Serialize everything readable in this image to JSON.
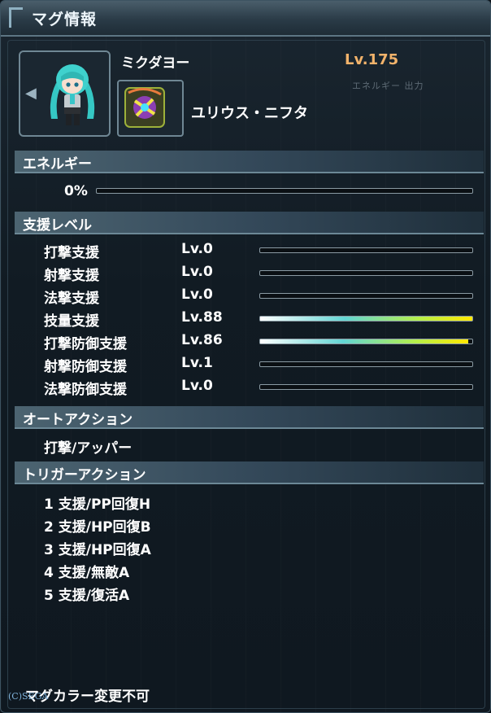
{
  "window": {
    "title": "マグ情報"
  },
  "mag": {
    "name": "ミクダヨー",
    "level": "Lv.175",
    "type": "ユリウス・ニフタ"
  },
  "background_text": "エネルギー 出力",
  "energy": {
    "header": "エネルギー",
    "percent_label": "0%",
    "percent": 0
  },
  "support": {
    "header": "支援レベル",
    "items": [
      {
        "label": "打撃支援",
        "level": "Lv.0",
        "level_value": 0,
        "gauge": 0
      },
      {
        "label": "射撃支援",
        "level": "Lv.0",
        "level_value": 0,
        "gauge": 0
      },
      {
        "label": "法撃支援",
        "level": "Lv.0",
        "level_value": 0,
        "gauge": 0
      },
      {
        "label": "技量支援",
        "level": "Lv.88",
        "level_value": 88,
        "gauge": 1.0
      },
      {
        "label": "打撃防御支援",
        "level": "Lv.86",
        "level_value": 86,
        "gauge": 0.98
      },
      {
        "label": "射撃防御支援",
        "level": "Lv.1",
        "level_value": 1,
        "gauge": 0
      },
      {
        "label": "法撃防御支援",
        "level": "Lv.0",
        "level_value": 0,
        "gauge": 0
      }
    ]
  },
  "auto_action": {
    "header": "オートアクション",
    "value": "打撃/アッパー"
  },
  "trigger_action": {
    "header": "トリガーアクション",
    "items": [
      "1 支援/PP回復H",
      "2 支援/HP回復B",
      "3 支援/HP回復A",
      "4 支援/無敵A",
      "5 支援/復活A"
    ]
  },
  "footer": {
    "color_change": "マグカラー変更不可",
    "copyright": "(C)SEGA"
  },
  "colors": {
    "level_orange": "#f2b36b",
    "gauge_gradient_end": "#ffe800",
    "section_bar": "#4c6471"
  },
  "icons": {
    "portrait": "mag-character-portrait",
    "weapon": "photon-blast-icon",
    "nav": "arrow-left-icon"
  }
}
